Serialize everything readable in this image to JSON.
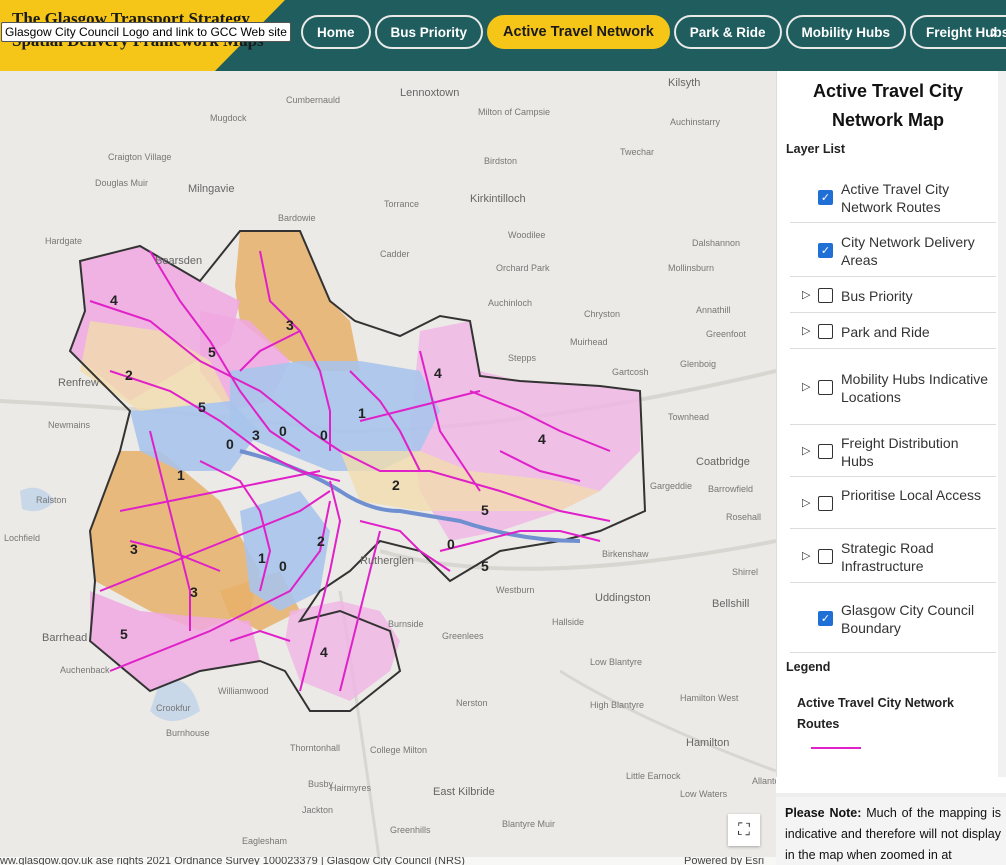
{
  "header": {
    "title_line1": "The Glasgow Transport Strategy",
    "title_line2": "Spatial Delivery Framework Maps",
    "logo_tooltip": "Glasgow City Council Logo and link to GCC Web site",
    "brand_color": "#f5c518",
    "bar_color": "#1f5d5f"
  },
  "nav": {
    "tabs": [
      {
        "label": "Home",
        "active": false
      },
      {
        "label": "Bus Priority",
        "active": false
      },
      {
        "label": "Active Travel Network",
        "active": true
      },
      {
        "label": "Park & Ride",
        "active": false
      },
      {
        "label": "Mobility Hubs",
        "active": false
      },
      {
        "label": "Freight Hubs",
        "active": false
      }
    ],
    "more_icon": "chevron-right-icon"
  },
  "map": {
    "places": [
      {
        "name": "Kilsyth",
        "big": true
      },
      {
        "name": "Lennoxtown",
        "big": true
      },
      {
        "name": "Milngavie",
        "big": true
      },
      {
        "name": "Bearsden",
        "big": true
      },
      {
        "name": "Kirkintilloch",
        "big": true
      },
      {
        "name": "Renfrew",
        "big": true
      },
      {
        "name": "Coatbridge",
        "big": true
      },
      {
        "name": "Uddingston",
        "big": true
      },
      {
        "name": "Bellshill",
        "big": true
      },
      {
        "name": "Rutherglen",
        "big": true
      },
      {
        "name": "Barrhead",
        "big": true
      },
      {
        "name": "East Kilbride",
        "big": true
      },
      {
        "name": "Hamilton",
        "big": true
      },
      {
        "name": "Cumbernauld",
        "big": false
      },
      {
        "name": "Mugdock",
        "big": false
      },
      {
        "name": "Craigton Village",
        "big": false
      },
      {
        "name": "Douglas Muir",
        "big": false
      },
      {
        "name": "Torrance",
        "big": false
      },
      {
        "name": "Birdston",
        "big": false
      },
      {
        "name": "Twechar",
        "big": false
      },
      {
        "name": "Auchinstarry",
        "big": false
      },
      {
        "name": "Milton of Campsie",
        "big": false
      },
      {
        "name": "Bardowie",
        "big": false
      },
      {
        "name": "Hardgate",
        "big": false
      },
      {
        "name": "Cadder",
        "big": false
      },
      {
        "name": "Woodilee",
        "big": false
      },
      {
        "name": "Dalshannon",
        "big": false
      },
      {
        "name": "Mollinsburn",
        "big": false
      },
      {
        "name": "Orchard Park",
        "big": false
      },
      {
        "name": "Auchinloch",
        "big": false
      },
      {
        "name": "Chryston",
        "big": false
      },
      {
        "name": "Annathill",
        "big": false
      },
      {
        "name": "Greenfoot",
        "big": false
      },
      {
        "name": "Muirhead",
        "big": false
      },
      {
        "name": "Stepps",
        "big": false
      },
      {
        "name": "Glenboig",
        "big": false
      },
      {
        "name": "Gartcosh",
        "big": false
      },
      {
        "name": "Townhead",
        "big": false
      },
      {
        "name": "Gargeddie",
        "big": false
      },
      {
        "name": "Barrowfield",
        "big": false
      },
      {
        "name": "Rosehall",
        "big": false
      },
      {
        "name": "Birkenshaw",
        "big": false
      },
      {
        "name": "Shirrel",
        "big": false
      },
      {
        "name": "Westburn",
        "big": false
      },
      {
        "name": "Burnside",
        "big": false
      },
      {
        "name": "Hallside",
        "big": false
      },
      {
        "name": "Greenlees",
        "big": false
      },
      {
        "name": "Low Blantyre",
        "big": false
      },
      {
        "name": "High Blantyre",
        "big": false
      },
      {
        "name": "Nerston",
        "big": false
      },
      {
        "name": "Thorntonhall",
        "big": false
      },
      {
        "name": "Busby",
        "big": false
      },
      {
        "name": "Jackton",
        "big": false
      },
      {
        "name": "Eaglesham",
        "big": false
      },
      {
        "name": "Greenhills",
        "big": false
      },
      {
        "name": "Newmains",
        "big": false
      },
      {
        "name": "Ralston",
        "big": false
      },
      {
        "name": "Lochfield",
        "big": false
      },
      {
        "name": "Auchenback",
        "big": false
      },
      {
        "name": "Williamwood",
        "big": false
      },
      {
        "name": "Crookfur",
        "big": false
      },
      {
        "name": "Burnhouse",
        "big": false
      },
      {
        "name": "Hairmyres",
        "big": false
      },
      {
        "name": "College Milton",
        "big": false
      },
      {
        "name": "Allanton",
        "big": false
      },
      {
        "name": "Low Waters",
        "big": false
      },
      {
        "name": "Blantyre Muir",
        "big": false
      },
      {
        "name": "Little Earnock",
        "big": false
      },
      {
        "name": "Hamilton West",
        "big": false
      }
    ],
    "zone_numbers": [
      "4",
      "3",
      "5",
      "2",
      "5",
      "4",
      "0",
      "3",
      "0",
      "0",
      "1",
      "4",
      "1",
      "2",
      "5",
      "0",
      "5",
      "3",
      "2",
      "1",
      "0",
      "3",
      "5",
      "4"
    ],
    "expand_icon": "fullscreen-icon",
    "attribution": "ww.glasgow.gov.uk  ase rights 2021 Ordnance Survey 100023379 | Glasgow City Council (NRS)",
    "powered_by": "Powered by Esri",
    "route_color": "#e020c8",
    "boundary_color": "#333333"
  },
  "panel": {
    "title": "Active Travel City Network Map",
    "layer_list_label": "Layer List",
    "layers": [
      {
        "label": "Active Travel City Network Routes",
        "checked": true,
        "expandable": false
      },
      {
        "label": "City Network Delivery Areas",
        "checked": true,
        "expandable": false
      },
      {
        "label": "Bus Priority",
        "checked": false,
        "expandable": true
      },
      {
        "label": "Park and Ride",
        "checked": false,
        "expandable": true
      },
      {
        "label": "Mobility Hubs Indicative Locations",
        "checked": false,
        "expandable": true
      },
      {
        "label": "Freight Distribution Hubs",
        "checked": false,
        "expandable": true
      },
      {
        "label": "Prioritise Local Access",
        "checked": false,
        "expandable": true
      },
      {
        "label": "Strategic Road Infrastructure",
        "checked": false,
        "expandable": true
      },
      {
        "label": "Glasgow City Council Boundary",
        "checked": true,
        "expandable": false
      }
    ],
    "legend_label": "Legend",
    "legend_item": "Active Travel City Network Routes",
    "note_bold": "Please Note:",
    "note_text": " Much of the mapping is indicative and therefore will not display in the map when zoomed in at"
  }
}
